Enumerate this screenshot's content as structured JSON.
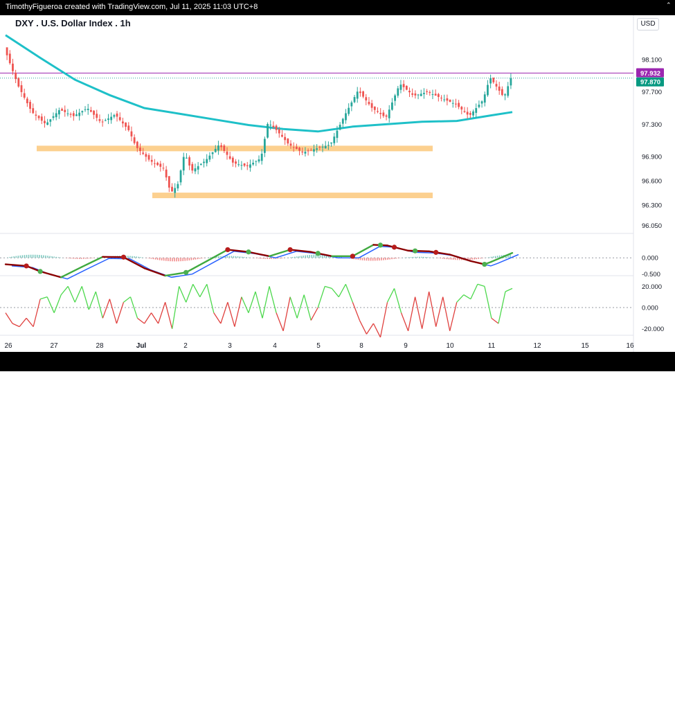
{
  "header": {
    "caption": "TimothyFigueroa created with TradingView.com, Jul 11, 2025 11:03 UTC+8",
    "symbol": "DXY . U.S. Dollar Index . 1h",
    "currency": "USD"
  },
  "footer": {
    "brand": "TradingView"
  },
  "colors": {
    "up_candle": "#26a69a",
    "down_candle": "#ef5350",
    "moving_average": "#1ec0c8",
    "zone": "#fcd08f",
    "price_line": "#9c27b0",
    "indicator_green": "#3fa93f",
    "indicator_red": "#8b0000",
    "indicator_blue": "#2962ff",
    "osc_green": "#4cd84c",
    "osc_red": "#e0403e"
  },
  "chart_data": {
    "type": "candlestick",
    "title": "DXY . U.S. Dollar Index . 1h",
    "x_axis_labels": [
      "26",
      "27",
      "28",
      "Jul",
      "2",
      "3",
      "4",
      "5",
      "8",
      "9",
      "10",
      "11",
      "12",
      "15",
      "16"
    ],
    "y_axis": {
      "ticks": [
        "98.100",
        "97.700",
        "97.300",
        "96.900",
        "96.600",
        "96.300",
        "96.050"
      ],
      "ylim": [
        95.95,
        98.45
      ]
    },
    "price_labels": {
      "horizontal_line": "97.932",
      "last_price": "97.870"
    },
    "support_zones": [
      {
        "value": 97.0,
        "from": "26",
        "to": "9"
      },
      {
        "value": 96.42,
        "from": "Jul",
        "to": "9"
      }
    ],
    "price_path": [
      [
        0,
        98.25
      ],
      [
        2,
        97.78
      ],
      [
        4,
        97.45
      ],
      [
        6,
        97.3
      ],
      [
        8,
        97.48
      ],
      [
        10,
        97.4
      ],
      [
        12,
        97.5
      ],
      [
        14,
        97.32
      ],
      [
        16,
        97.42
      ],
      [
        18,
        97.22
      ],
      [
        19,
        97.02
      ],
      [
        21,
        96.85
      ],
      [
        23,
        96.75
      ],
      [
        24,
        96.45
      ],
      [
        25,
        96.55
      ],
      [
        26,
        96.95
      ],
      [
        27,
        96.72
      ],
      [
        29,
        96.85
      ],
      [
        31,
        97.05
      ],
      [
        33,
        96.82
      ],
      [
        35,
        96.78
      ],
      [
        37,
        96.88
      ],
      [
        38,
        97.32
      ],
      [
        39,
        97.25
      ],
      [
        41,
        97.05
      ],
      [
        43,
        96.95
      ],
      [
        45,
        97.0
      ],
      [
        47,
        97.05
      ],
      [
        49,
        97.4
      ],
      [
        51,
        97.72
      ],
      [
        53,
        97.5
      ],
      [
        55,
        97.38
      ],
      [
        57,
        97.8
      ],
      [
        59,
        97.65
      ],
      [
        61,
        97.7
      ],
      [
        63,
        97.62
      ],
      [
        65,
        97.55
      ],
      [
        67,
        97.4
      ],
      [
        68,
        97.5
      ],
      [
        69,
        97.6
      ],
      [
        70,
        97.88
      ],
      [
        72,
        97.63
      ],
      [
        73,
        97.87
      ]
    ],
    "moving_average_path": [
      [
        0,
        98.4
      ],
      [
        5,
        98.12
      ],
      [
        10,
        97.85
      ],
      [
        15,
        97.66
      ],
      [
        20,
        97.5
      ],
      [
        25,
        97.43
      ],
      [
        30,
        97.36
      ],
      [
        35,
        97.29
      ],
      [
        40,
        97.24
      ],
      [
        45,
        97.21
      ],
      [
        50,
        97.27
      ],
      [
        55,
        97.3
      ],
      [
        60,
        97.33
      ],
      [
        65,
        97.34
      ],
      [
        70,
        97.41
      ],
      [
        73,
        97.45
      ]
    ],
    "momentum_panel": {
      "ticks": [
        "0.000",
        "-0.500"
      ],
      "ylim": [
        -0.55,
        0.75
      ],
      "signal_path": [
        [
          0,
          -0.2
        ],
        [
          3,
          -0.25
        ],
        [
          5,
          -0.42
        ],
        [
          8,
          -0.6
        ],
        [
          11,
          -0.28
        ],
        [
          14,
          0.03
        ],
        [
          17,
          0.02
        ],
        [
          20,
          -0.32
        ],
        [
          23,
          -0.55
        ],
        [
          26,
          -0.45
        ],
        [
          29,
          -0.1
        ],
        [
          32,
          0.25
        ],
        [
          35,
          0.18
        ],
        [
          38,
          0.05
        ],
        [
          41,
          0.25
        ],
        [
          44,
          0.18
        ],
        [
          47,
          0.05
        ],
        [
          50,
          0.05
        ],
        [
          53,
          0.4
        ],
        [
          55,
          0.38
        ],
        [
          58,
          0.22
        ],
        [
          61,
          0.2
        ],
        [
          64,
          0.1
        ],
        [
          67,
          -0.1
        ],
        [
          69,
          -0.2
        ],
        [
          70,
          -0.12
        ],
        [
          73,
          0.15
        ]
      ],
      "green_dots": [
        5,
        26,
        35,
        45,
        54,
        59,
        69
      ],
      "red_dots": [
        3,
        17,
        32,
        41,
        50,
        56,
        62
      ]
    },
    "oscillator_panel": {
      "ticks": [
        "20.000",
        "0.000",
        "-20.000"
      ],
      "ylim": [
        -30,
        30
      ],
      "path": [
        [
          0,
          -5
        ],
        [
          1,
          -15
        ],
        [
          2,
          -18
        ],
        [
          3,
          -10
        ],
        [
          4,
          -18
        ],
        [
          5,
          8
        ],
        [
          6,
          10
        ],
        [
          7,
          -5
        ],
        [
          8,
          12
        ],
        [
          9,
          20
        ],
        [
          10,
          5
        ],
        [
          11,
          20
        ],
        [
          12,
          -2
        ],
        [
          13,
          15
        ],
        [
          14,
          -10
        ],
        [
          15,
          8
        ],
        [
          16,
          -15
        ],
        [
          17,
          5
        ],
        [
          18,
          10
        ],
        [
          19,
          -10
        ],
        [
          20,
          -15
        ],
        [
          21,
          -5
        ],
        [
          22,
          -15
        ],
        [
          23,
          5
        ],
        [
          24,
          -20
        ],
        [
          25,
          20
        ],
        [
          26,
          5
        ],
        [
          27,
          22
        ],
        [
          28,
          10
        ],
        [
          29,
          22
        ],
        [
          30,
          -5
        ],
        [
          31,
          -15
        ],
        [
          32,
          5
        ],
        [
          33,
          -18
        ],
        [
          34,
          10
        ],
        [
          35,
          -5
        ],
        [
          36,
          15
        ],
        [
          37,
          -10
        ],
        [
          38,
          20
        ],
        [
          39,
          -5
        ],
        [
          40,
          -22
        ],
        [
          41,
          10
        ],
        [
          42,
          -10
        ],
        [
          43,
          12
        ],
        [
          44,
          -12
        ],
        [
          45,
          0
        ],
        [
          46,
          20
        ],
        [
          47,
          18
        ],
        [
          48,
          10
        ],
        [
          49,
          22
        ],
        [
          50,
          5
        ],
        [
          51,
          -12
        ],
        [
          52,
          -25
        ],
        [
          53,
          -15
        ],
        [
          54,
          -28
        ],
        [
          55,
          5
        ],
        [
          56,
          18
        ],
        [
          57,
          -5
        ],
        [
          58,
          -22
        ],
        [
          59,
          10
        ],
        [
          60,
          -20
        ],
        [
          61,
          15
        ],
        [
          62,
          -18
        ],
        [
          63,
          10
        ],
        [
          64,
          -22
        ],
        [
          65,
          5
        ],
        [
          66,
          12
        ],
        [
          67,
          8
        ],
        [
          68,
          22
        ],
        [
          69,
          20
        ],
        [
          70,
          -10
        ],
        [
          71,
          -15
        ],
        [
          72,
          15
        ],
        [
          73,
          18
        ]
      ]
    }
  }
}
